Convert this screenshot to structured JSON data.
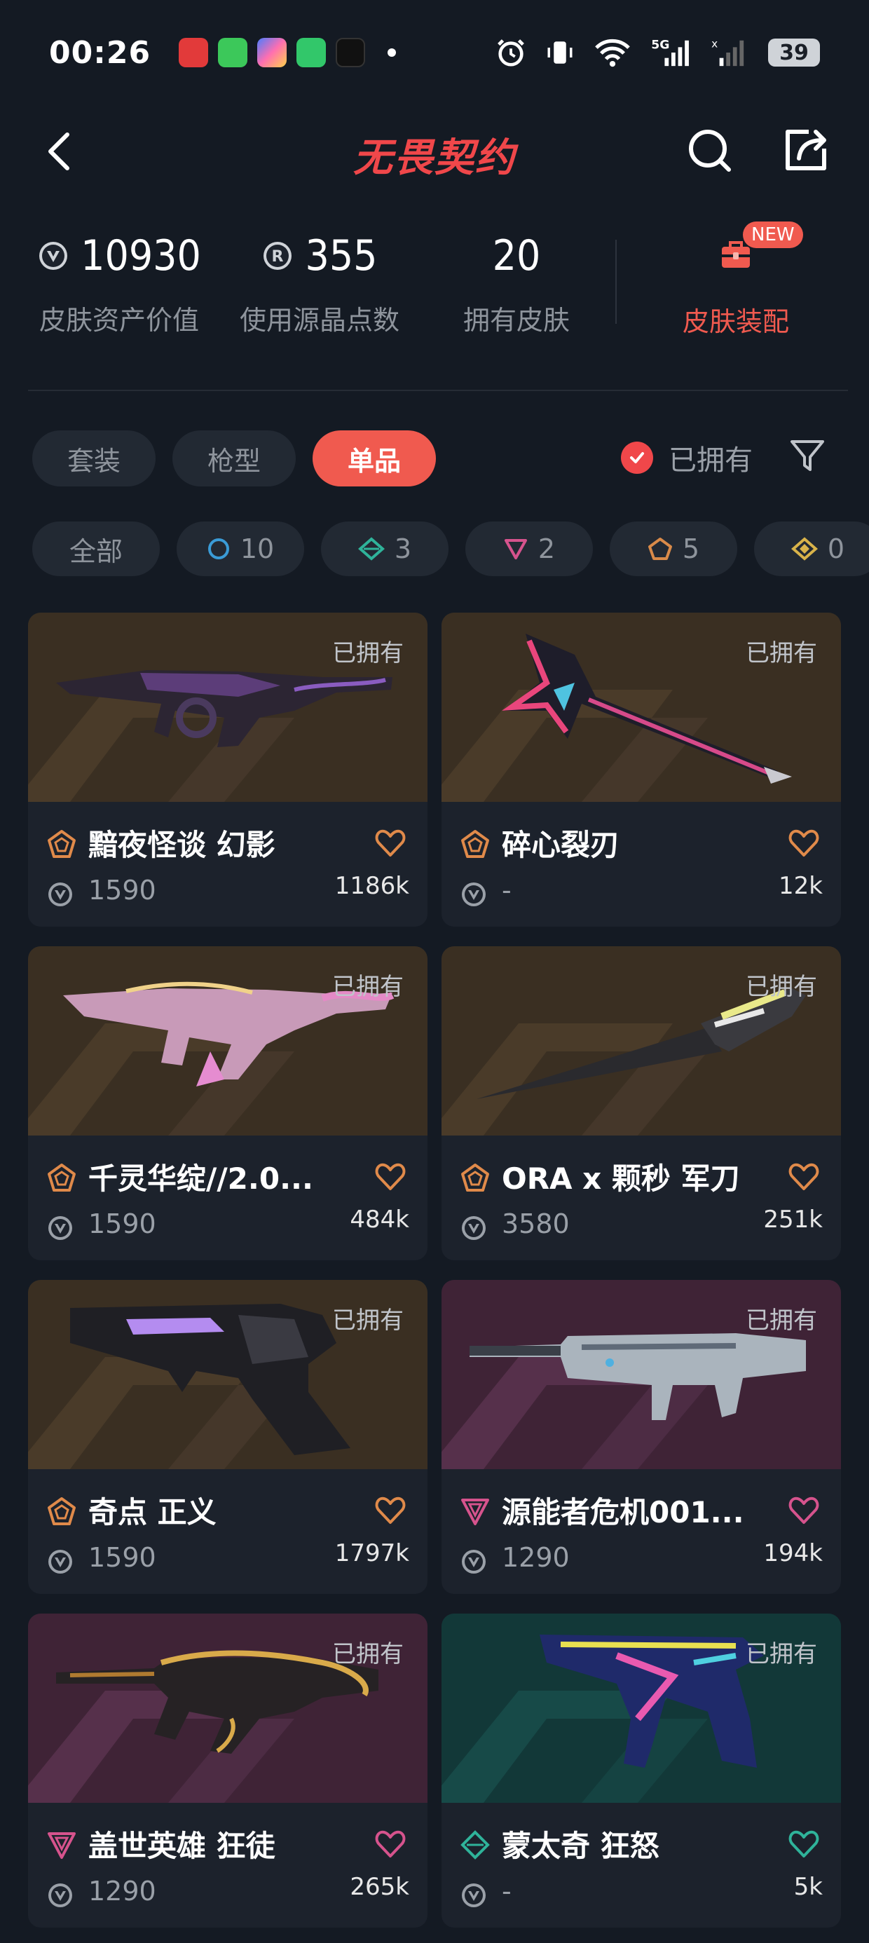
{
  "status_bar": {
    "time": "00:26",
    "battery": "39"
  },
  "header": {
    "title": "无畏契约",
    "back_icon": "chevron-left-icon",
    "search_icon": "search-icon",
    "share_icon": "share-icon"
  },
  "stats": {
    "asset_value": "10930",
    "asset_value_label": "皮肤资产价值",
    "radianite": "355",
    "radianite_label": "使用源晶点数",
    "owned_skins": "20",
    "owned_skins_label": "拥有皮肤",
    "outfit_label": "皮肤装配",
    "new_badge": "NEW"
  },
  "tabs": [
    {
      "label": "套装",
      "active": false
    },
    {
      "label": "枪型",
      "active": false
    },
    {
      "label": "单品",
      "active": true
    }
  ],
  "owned_filter_label": "已拥有",
  "tier_chips": [
    {
      "label": "全部",
      "icon": "",
      "count": ""
    },
    {
      "label": "",
      "icon": "ring-icon",
      "count": "10",
      "color": "#3a9bd6"
    },
    {
      "label": "",
      "icon": "diamond-icon",
      "count": "3",
      "color": "#2fb39a"
    },
    {
      "label": "",
      "icon": "triangle-icon",
      "count": "2",
      "color": "#d6538d"
    },
    {
      "label": "",
      "icon": "pentagon-icon",
      "count": "5",
      "color": "#d98a49"
    },
    {
      "label": "",
      "icon": "diamond-icon",
      "count": "0",
      "color": "#d9b34a"
    }
  ],
  "owned_tag": "已拥有",
  "cards": [
    {
      "name": "黯夜怪谈 幻影",
      "price": "1590",
      "likes": "1186k",
      "tier": "pentagon",
      "tier_color": "#e08a4a",
      "bg": "brown"
    },
    {
      "name": "碎心裂刃",
      "price": "-",
      "likes": "12k",
      "tier": "pentagon",
      "tier_color": "#e08a4a",
      "bg": "brown"
    },
    {
      "name": "千灵华绽//2.0...",
      "price": "1590",
      "likes": "484k",
      "tier": "pentagon",
      "tier_color": "#e08a4a",
      "bg": "brown"
    },
    {
      "name": "ORA x 颗秒 军刀",
      "price": "3580",
      "likes": "251k",
      "tier": "pentagon",
      "tier_color": "#e08a4a",
      "bg": "brown"
    },
    {
      "name": "奇点 正义",
      "price": "1590",
      "likes": "1797k",
      "tier": "pentagon",
      "tier_color": "#e08a4a",
      "bg": "brown"
    },
    {
      "name": "源能者危机001...",
      "price": "1290",
      "likes": "194k",
      "tier": "triangle",
      "tier_color": "#d6538d",
      "bg": "purple"
    },
    {
      "name": "盖世英雄 狂徒",
      "price": "1290",
      "likes": "265k",
      "tier": "triangle",
      "tier_color": "#d6538d",
      "bg": "purple"
    },
    {
      "name": "蒙太奇 狂怒",
      "price": "-",
      "likes": "5k",
      "tier": "diamond",
      "tier_color": "#2fb39a",
      "bg": "teal"
    }
  ]
}
